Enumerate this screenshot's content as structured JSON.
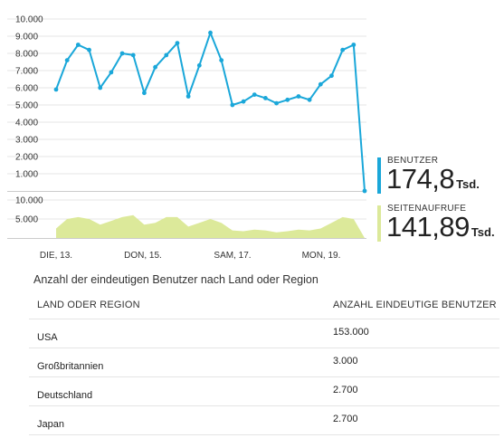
{
  "chart_data": [
    {
      "type": "line",
      "title": "",
      "categories": [
        "DIE, 13.",
        "DON, 15.",
        "SAM, 17.",
        "MON, 19."
      ],
      "ylim": [
        0,
        10000
      ],
      "yticks": [
        "1.000",
        "2.000",
        "3.000",
        "4.000",
        "5.000",
        "6.000",
        "7.000",
        "8.000",
        "9.000",
        "10.000"
      ],
      "grid": true,
      "series": [
        {
          "name": "BENUTZER",
          "color": "#1aa7d9",
          "values": [
            5900,
            7600,
            8500,
            8200,
            6000,
            6900,
            8000,
            7900,
            5700,
            7200,
            7900,
            8600,
            5500,
            7300,
            9200,
            7600,
            5000,
            5200,
            5600,
            5400,
            5100,
            5300,
            5500,
            5300,
            6200,
            6700,
            8200,
            8500,
            0
          ]
        }
      ]
    },
    {
      "type": "area",
      "title": "",
      "categories": [
        "DIE, 13.",
        "DON, 15.",
        "SAM, 17.",
        "MON, 19."
      ],
      "ylim": [
        0,
        10000
      ],
      "yticks": [
        "5.000",
        "10.000"
      ],
      "grid": true,
      "series": [
        {
          "name": "SEITENAUFRUFE",
          "color": "#dce99a",
          "values": [
            2500,
            5000,
            5500,
            5000,
            3500,
            4500,
            5500,
            6000,
            3500,
            4000,
            5500,
            5500,
            3000,
            4000,
            5000,
            4000,
            2000,
            1800,
            2200,
            2000,
            1500,
            1800,
            2200,
            2000,
            2500,
            4000,
            5500,
            5000,
            0
          ]
        }
      ]
    }
  ],
  "legend": {
    "users": {
      "label": "BENUTZER",
      "value": "174,8",
      "unit": "Tsd.",
      "color": "#1aa7d9"
    },
    "views": {
      "label": "SEITENAUFRUFE",
      "value": "141,89",
      "unit": "Tsd.",
      "color": "#dce99a"
    }
  },
  "table": {
    "title": "Anzahl der eindeutigen Benutzer nach Land oder Region",
    "headers": [
      "LAND ODER REGION",
      "ANZAHL EINDEUTIGE BENUTZER"
    ],
    "rows": [
      [
        "USA",
        "153.000"
      ],
      [
        "Großbritannien",
        "3.000"
      ],
      [
        "Deutschland",
        "2.700"
      ],
      [
        "Japan",
        "2.700"
      ]
    ]
  }
}
